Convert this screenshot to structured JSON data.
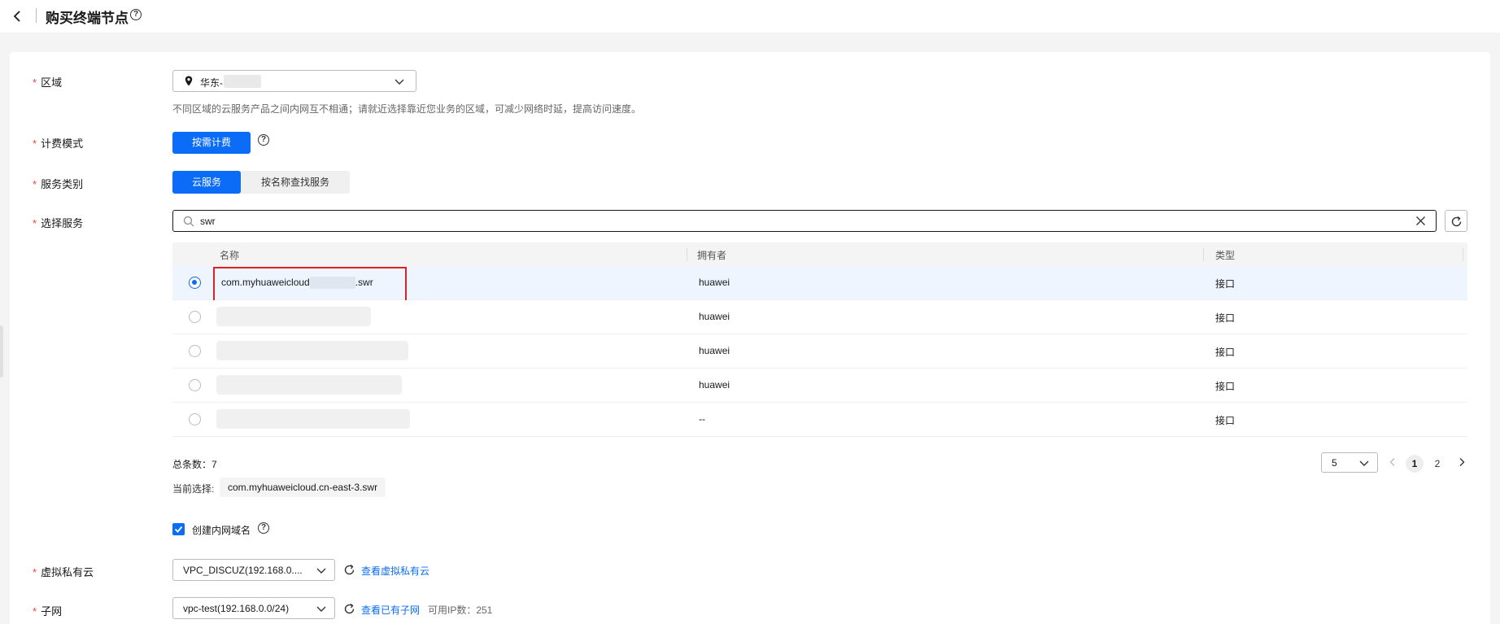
{
  "header": {
    "title": "购买终端节点"
  },
  "form": {
    "region": {
      "label": "区域",
      "value": "华东-",
      "hint": "不同区域的云服务产品之间内网互不相通；请就近选择靠近您业务的区域，可减少网络时延，提高访问速度。"
    },
    "billing": {
      "label": "计费模式",
      "option": "按需计费"
    },
    "service_type": {
      "label": "服务类别",
      "options": [
        "云服务",
        "按名称查找服务"
      ],
      "selected": "云服务"
    },
    "service": {
      "label": "选择服务",
      "search_value": "swr"
    }
  },
  "table": {
    "columns": [
      "名称",
      "拥有者",
      "类型"
    ],
    "rows": [
      {
        "name_prefix": "com.myhuaweicloud",
        "name_suffix": ".swr",
        "owner": "huawei",
        "type": "接口",
        "selected": true
      },
      {
        "owner": "huawei",
        "type": "接口",
        "selected": false
      },
      {
        "owner": "huawei",
        "type": "接口",
        "selected": false
      },
      {
        "owner": "huawei",
        "type": "接口",
        "selected": false
      },
      {
        "owner": "--",
        "type": "接口",
        "selected": false
      }
    ]
  },
  "summary": {
    "total_label": "总条数：7",
    "current_label": "当前选择:",
    "current_value": "com.myhuaweicloud.cn-east-3.swr"
  },
  "pagination": {
    "page_size": "5",
    "pages": [
      "1",
      "2"
    ],
    "current": "1"
  },
  "create_domain": {
    "label": "创建内网域名",
    "checked": true
  },
  "vpc": {
    "label": "虚拟私有云",
    "value": "VPC_DISCUZ(192.168.0....",
    "link": "查看虚拟私有云"
  },
  "subnet": {
    "label": "子网",
    "value": "vpc-test(192.168.0.0/24)",
    "link": "查看已有子网",
    "ip_info": "可用IP数：251"
  },
  "colors": {
    "primary": "#0a6cf7",
    "required": "#e54545",
    "highlight": "#e02020"
  }
}
